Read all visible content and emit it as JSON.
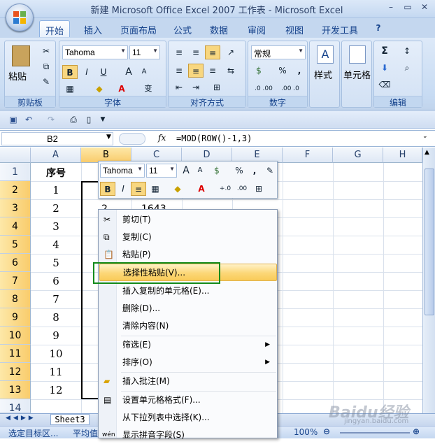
{
  "window": {
    "title": "新建 Microsoft Office Excel 2007 工作表 - Microsoft Excel",
    "min": "–",
    "max": "▭",
    "close": "✕"
  },
  "tabs": [
    "开始",
    "插入",
    "页面布局",
    "公式",
    "数据",
    "审阅",
    "视图",
    "开发工具"
  ],
  "ribbon": {
    "clipboard": {
      "label": "剪贴板",
      "paste": "粘贴"
    },
    "font": {
      "label": "字体",
      "name": "Tahoma",
      "size": "11",
      "bold": "B",
      "italic": "I",
      "underline": "U",
      "grow": "A",
      "shrink": "A",
      "phonetic": "变"
    },
    "align": {
      "label": "对齐方式"
    },
    "number": {
      "label": "数字",
      "format": "常规",
      "percent": "%",
      "comma": ",",
      "inc": ".0 .00",
      "dec": ".00 .0"
    },
    "styles": {
      "label": "样式"
    },
    "cells": {
      "label": "单元格"
    },
    "editing": {
      "label": "编辑",
      "sum": "Σ"
    }
  },
  "formula_bar": {
    "name_box": "B2",
    "fx": "fx",
    "formula": "=MOD(ROW()-1,3)"
  },
  "columns": [
    "A",
    "B",
    "C",
    "D",
    "E",
    "F",
    "G",
    "H"
  ],
  "rows": [
    "1",
    "2",
    "3",
    "4",
    "5",
    "6",
    "7",
    "8",
    "9",
    "10",
    "11",
    "12",
    "13",
    "14"
  ],
  "col_a": [
    "序号",
    "1",
    "2",
    "3",
    "4",
    "5",
    "6",
    "7",
    "8",
    "9",
    "10",
    "11",
    "12"
  ],
  "cells": {
    "b3": "2",
    "c3": "1643"
  },
  "mini_toolbar": {
    "font": "Tahoma",
    "size": "11",
    "percent": "%",
    "comma": ","
  },
  "context_menu": [
    {
      "label": "剪切(T)",
      "icon": "scissors-icon"
    },
    {
      "label": "复制(C)",
      "icon": "copy-icon"
    },
    {
      "label": "粘贴(P)",
      "icon": "paste-icon"
    },
    {
      "label": "选择性粘贴(V)...",
      "highlight": true
    },
    {
      "label": "插入复制的单元格(E)..."
    },
    {
      "label": "删除(D)..."
    },
    {
      "label": "清除内容(N)"
    },
    {
      "label": "筛选(E)",
      "submenu": true
    },
    {
      "label": "排序(O)",
      "submenu": true
    },
    {
      "label": "插入批注(M)",
      "icon": "comment-icon"
    },
    {
      "label": "设置单元格格式(F)...",
      "icon": "format-icon"
    },
    {
      "label": "从下拉列表中选择(K)..."
    },
    {
      "label": "显示拼音字段(S)",
      "icon": "phonetic-icon"
    }
  ],
  "sheet_tab": "Sheet3",
  "status": {
    "left": "选定目标区...",
    "avg": "平均值",
    "zoom": "100%"
  },
  "watermark": {
    "main": "Baidu经验",
    "sub": "jingyan.baidu.com"
  }
}
